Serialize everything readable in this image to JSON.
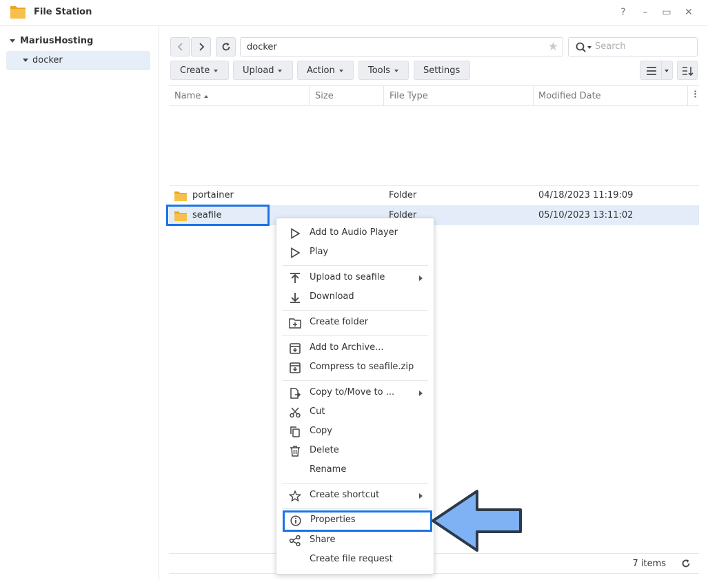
{
  "window": {
    "title": "File Station",
    "controls": [
      "?",
      "–",
      "▭",
      "✕"
    ]
  },
  "sidebar": {
    "root": "MariusHosting",
    "child": "docker"
  },
  "toolbar": {
    "path": "docker",
    "search_placeholder": "Search",
    "buttons": {
      "create": "Create",
      "upload": "Upload",
      "action": "Action",
      "tools": "Tools",
      "settings": "Settings"
    }
  },
  "table": {
    "columns": {
      "name": "Name",
      "size": "Size",
      "type": "File Type",
      "modified": "Modified Date"
    },
    "rows": [
      {
        "name": "portainer",
        "size": "",
        "type": "Folder",
        "modified": "04/18/2023 11:19:09"
      },
      {
        "name": "seafile",
        "size": "",
        "type": "Folder",
        "modified": "05/10/2023 13:11:02"
      }
    ]
  },
  "footer": {
    "count": "7 items"
  },
  "context_menu": {
    "items": {
      "add_audio": "Add to Audio Player",
      "play": "Play",
      "upload_to": "Upload to seafile",
      "download": "Download",
      "create_folder": "Create folder",
      "add_archive": "Add to Archive...",
      "compress": "Compress to seafile.zip",
      "copy_move": "Copy to/Move to ...",
      "cut": "Cut",
      "copy": "Copy",
      "delete": "Delete",
      "rename": "Rename",
      "create_shortcut": "Create shortcut",
      "properties": "Properties",
      "share": "Share",
      "create_file_request": "Create file request"
    }
  },
  "colors": {
    "accent": "#1a73e8",
    "arrow_fill": "#7fb1f5",
    "folder": "#f7c04a",
    "selected_row": "#e3ecf8"
  }
}
